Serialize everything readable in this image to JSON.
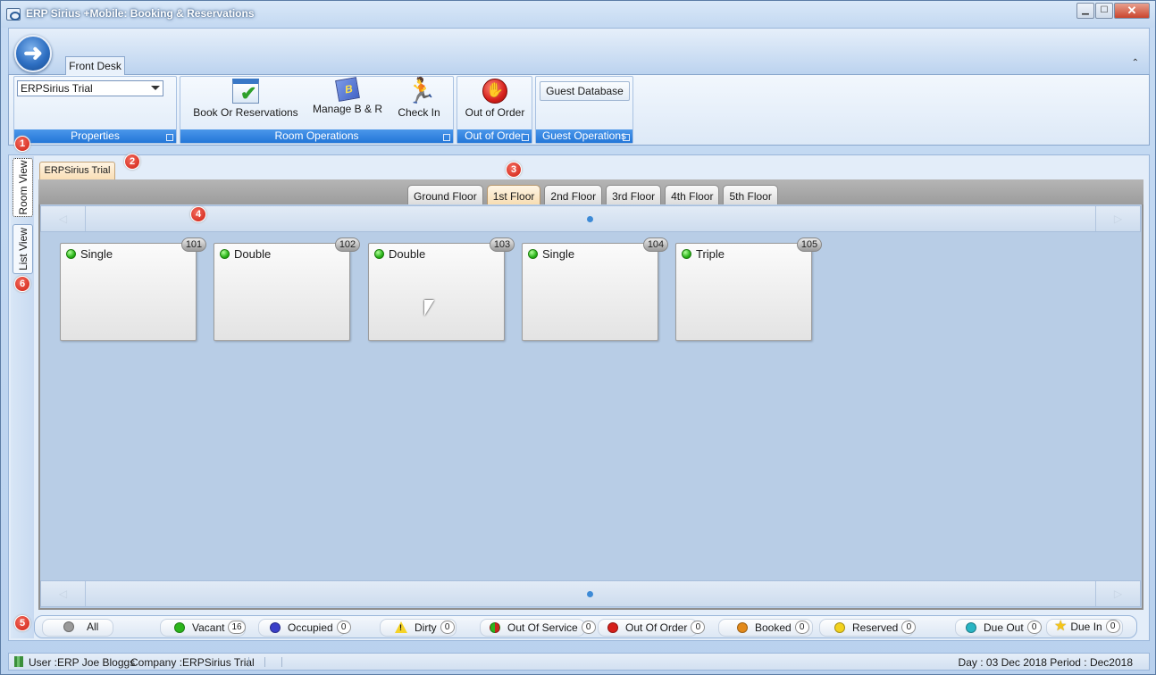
{
  "window": {
    "title": "ERP Sirius +Mobile: Booking & Reservations",
    "controls": {
      "minimize": "▁",
      "maximize": "☐",
      "close": "✕"
    }
  },
  "ribbon": {
    "back_icon": "arrow-left",
    "tab_label": "Front Desk",
    "collapse_glyph": "⌃",
    "groups": {
      "properties": {
        "label": "Properties",
        "select_value": "ERPSirius Trial"
      },
      "room_operations": {
        "label": "Room Operations",
        "book": "Book Or Reservations",
        "manage": "Manage B & R",
        "checkin": "Check In"
      },
      "out_of_order": {
        "label": "Out of Order",
        "button": "Out of Order"
      },
      "guest_operations": {
        "label": "Guest Operations",
        "button": "Guest Database"
      }
    }
  },
  "side_tabs": {
    "room_view": "Room View",
    "list_view": "List View"
  },
  "property_tab": "ERPSirius Trial",
  "floors": {
    "tabs": [
      "Ground Floor",
      "1st Floor",
      "2nd Floor",
      "3rd Floor",
      "4th Floor",
      "5th Floor"
    ],
    "active": "1st Floor"
  },
  "scroller": {
    "left_glyph": "◁",
    "right_glyph": "▷"
  },
  "rooms": [
    {
      "number": "101",
      "type": "Single",
      "status_color": "#2bb51b"
    },
    {
      "number": "102",
      "type": "Double",
      "status_color": "#2bb51b"
    },
    {
      "number": "103",
      "type": "Double",
      "status_color": "#2bb51b"
    },
    {
      "number": "104",
      "type": "Single",
      "status_color": "#2bb51b"
    },
    {
      "number": "105",
      "type": "Triple",
      "status_color": "#2bb51b"
    }
  ],
  "markers": [
    "1",
    "2",
    "3",
    "4",
    "5",
    "6"
  ],
  "legend": {
    "all": "All",
    "items": [
      {
        "label": "Vacant",
        "count": "16",
        "color": "#2bb51b"
      },
      {
        "label": "Occupied",
        "count": "0",
        "color": "#3a3fc8"
      },
      {
        "label": "Dirty",
        "count": "0",
        "color": "#f5d327"
      },
      {
        "label": "Out Of Service",
        "count": "0",
        "color": "#c8281c"
      },
      {
        "label": "Out Of Order",
        "count": "0",
        "color": "#d6201b"
      },
      {
        "label": "Booked",
        "count": "0",
        "color": "#e38a1b"
      },
      {
        "label": "Reserved",
        "count": "0",
        "color": "#f2d21e"
      },
      {
        "label": "Due Out",
        "count": "0",
        "color": "#29b5c4"
      },
      {
        "label": "Due In",
        "count": "0",
        "color": "#f5c518"
      }
    ]
  },
  "statusbar": {
    "user": "User :ERP Joe Bloggs",
    "company": "Company :ERPSirius Trial",
    "day_period": "Day : 03 Dec 2018  Period : Dec2018"
  }
}
